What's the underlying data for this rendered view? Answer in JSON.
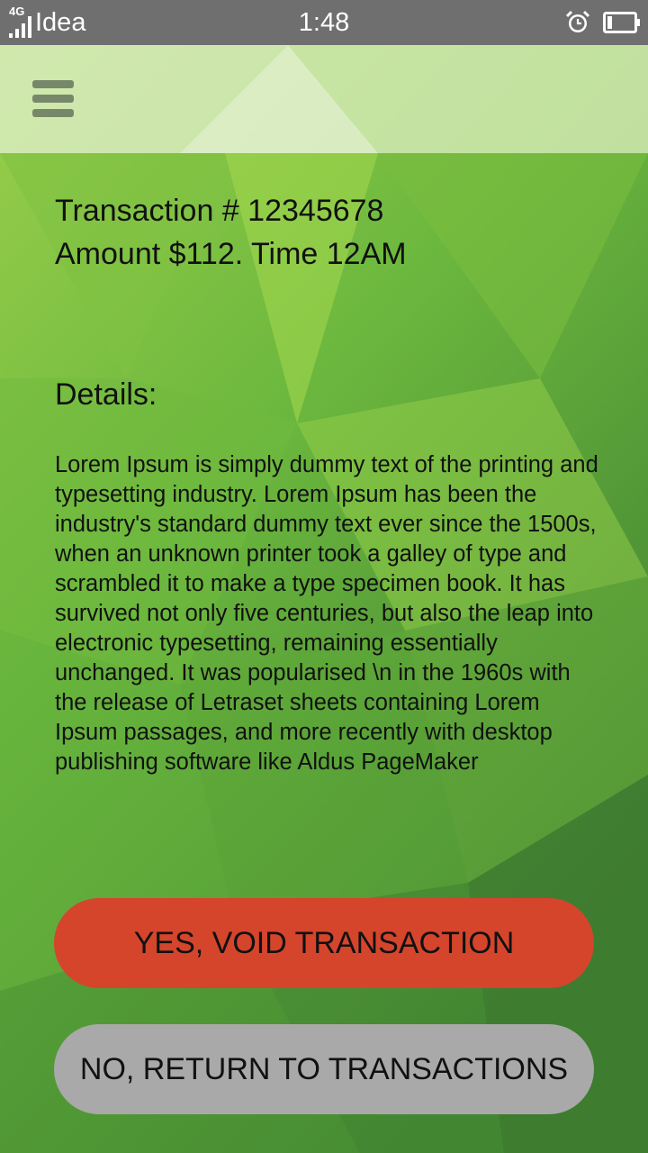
{
  "status_bar": {
    "network_type": "4G",
    "carrier": "Idea",
    "time": "1:48",
    "icons": [
      "signal-icon",
      "alarm-icon",
      "battery-icon"
    ]
  },
  "app_bar": {
    "menu_icon": "hamburger-menu-icon"
  },
  "transaction": {
    "number_line": "Transaction # 12345678",
    "amount_time_line": "Amount $112. Time 12AM",
    "details_label": "Details:",
    "details_text": "Lorem Ipsum is simply dummy text of the printing and typesetting industry. Lorem Ipsum has been the industry's standard dummy text ever since the 1500s, when an unknown printer took a galley of type and scrambled it to make a type specimen book. It has survived not only five centuries, but also the leap into electronic typesetting, remaining essentially unchanged. It was popularised \\n in the 1960s with the release of Letraset sheets containing Lorem Ipsum passages, and more recently with desktop publishing software like Aldus PageMaker"
  },
  "actions": {
    "void_label": "YES, VOID TRANSACTION",
    "return_label": "NO, RETURN TO TRANSACTIONS"
  },
  "colors": {
    "status_bar": "#6f6f6f",
    "background_green": "#6fb83f",
    "void_button": "#d4452c",
    "return_button": "#a9a9a9",
    "menu_icon": "#77886a"
  }
}
